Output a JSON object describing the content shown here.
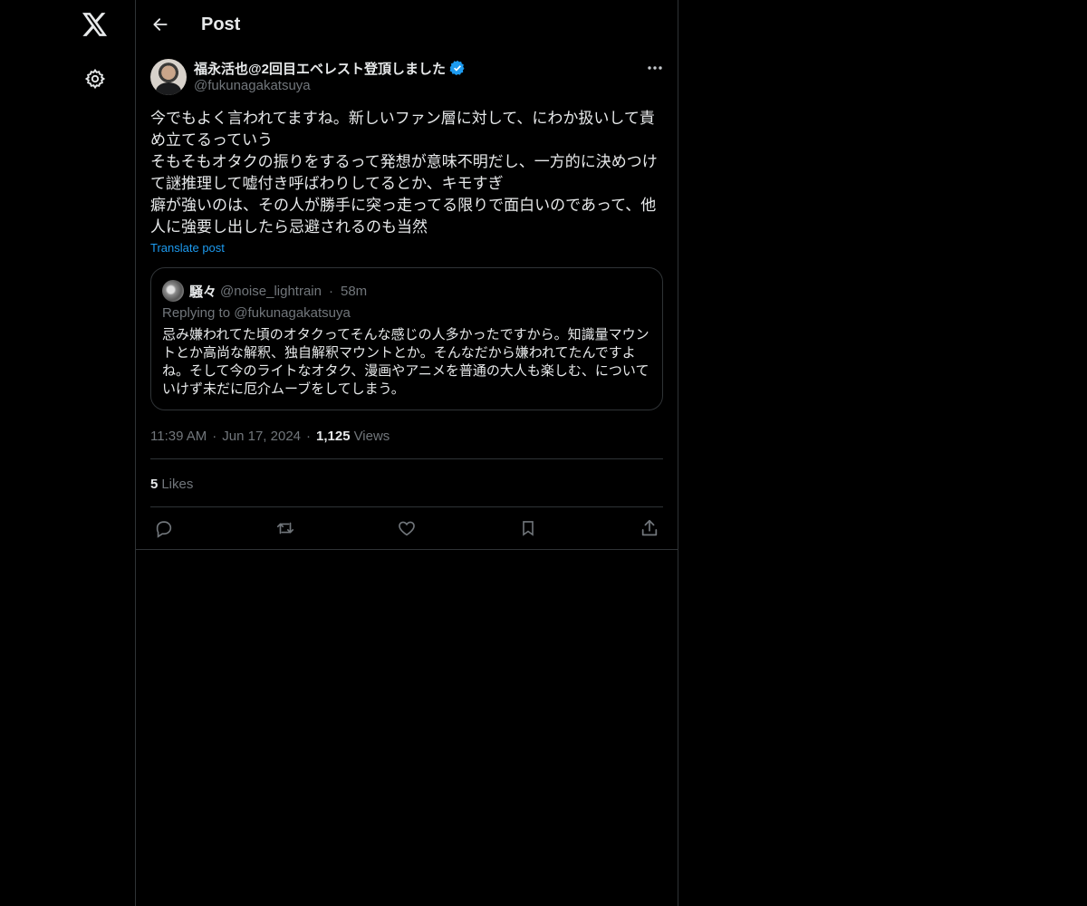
{
  "header": {
    "title": "Post"
  },
  "sidebar": {
    "icons": [
      "x-logo-icon",
      "gear-icon"
    ]
  },
  "post": {
    "author_name": "福永活也@2回目エベレスト登頂しました",
    "author_handle": "@fukunagakatsuya",
    "verified": true,
    "text_lines": [
      "今でもよく言われてますね。新しいファン層に対して、にわか扱いして責め立てるっていう",
      "そもそもオタクの振りをするって発想が意味不明だし、一方的に決めつけて謎推理して嘘付き呼ばわりしてるとか、キモすぎ",
      "癖が強いのは、その人が勝手に突っ走ってる限りで面白いのであって、他人に強要し出したら忌避されるのも当然"
    ],
    "translate_label": "Translate post",
    "time": "11:39 AM",
    "date": "Jun 17, 2024",
    "views_count": "1,125",
    "views_label": "Views",
    "likes_count": "5",
    "likes_label": "Likes",
    "separator": "·"
  },
  "quote": {
    "name": "騒々",
    "handle": "@noise_lightrain",
    "time": "58m",
    "separator": "·",
    "replying_to": "Replying to @fukunagakatsuya",
    "text": "忌み嫌われてた頃のオタクってそんな感じの人多かったですから。知識量マウントとか高尚な解釈、独自解釈マウントとか。そんなだから嫌われてたんですよね。そして今のライトなオタク、漫画やアニメを普通の大人も楽しむ、についていけず未だに厄介ムーブをしてしまう。"
  },
  "actions": [
    "reply-icon",
    "repost-icon",
    "like-icon",
    "bookmark-icon",
    "share-icon"
  ],
  "colors": {
    "accent": "#1d9bf0",
    "background": "#000000",
    "muted": "#71767b",
    "border": "#2f3336"
  }
}
